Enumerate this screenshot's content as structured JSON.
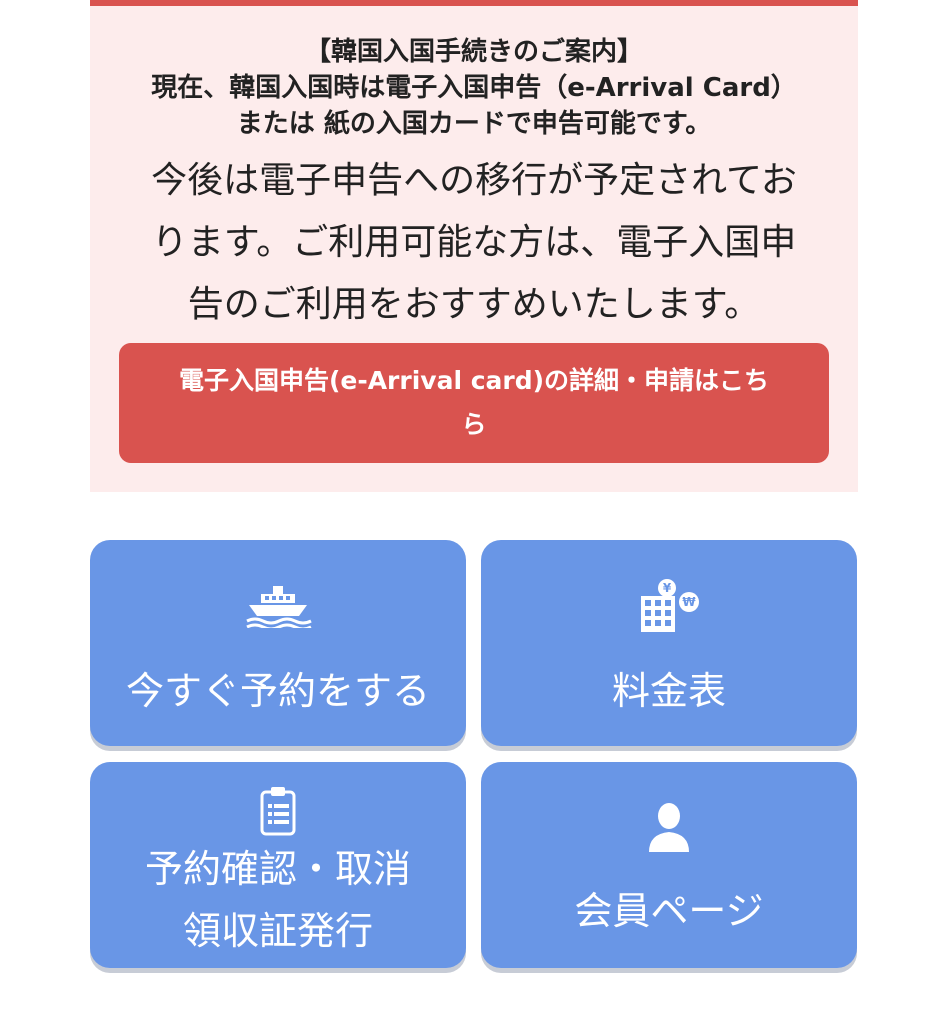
{
  "notice": {
    "heading_line1": "【韓国入国手続きのご案内】",
    "heading_line2": "現在、韓国入国時は電子入国申告（e-Arrival Card）",
    "heading_line3": "または 紙の入国カードで申告可能です。",
    "body_line1": "今後は電子申告への移行が予定されてお",
    "body_line2": "ります。ご利用可能な方は、電子入国申",
    "body_line3": "告のご利用をおすすめいたします。",
    "cta_line1": "電子入国申告(e-Arrival card)の詳細・申請はこち",
    "cta_line2": "ら"
  },
  "menu": {
    "book": {
      "label": "今すぐ予約をする",
      "icon": "ship-icon"
    },
    "fares": {
      "label": "料金表",
      "icon": "currency-building-icon"
    },
    "confirm": {
      "label_line1": "予約確認・取消",
      "label_line2": "領収証発行",
      "icon": "clipboard-icon"
    },
    "member": {
      "label": "会員ページ",
      "icon": "user-icon"
    }
  },
  "colors": {
    "accent_red": "#d9534f",
    "notice_bg": "#fdecec",
    "tile_blue": "#6996e6"
  }
}
